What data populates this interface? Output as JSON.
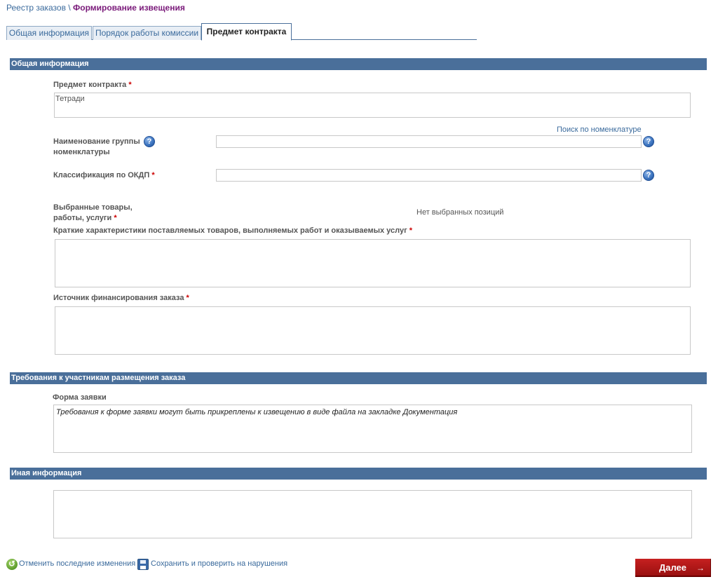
{
  "breadcrumb": {
    "root": "Реестр заказов",
    "separator": "\\",
    "current": "Формирование извещения"
  },
  "tabs": [
    {
      "label": "Общая информация",
      "active": false
    },
    {
      "label": "Порядок работы комиссии",
      "active": false
    },
    {
      "label": "Предмет контракта",
      "active": true
    }
  ],
  "sections": {
    "general": {
      "title": "Общая информация",
      "subject_label": "Предмет контракта",
      "subject_value": "Тетради",
      "search_link": "Поиск по номенклатуре",
      "group_label_line1": "Наименование группы",
      "group_label_line2": "номенклатуры",
      "group_value": "",
      "okdp_label": "Классификация по ОКДП",
      "okdp_value": "",
      "selected_label_line1": "Выбранные товары,",
      "selected_label_line2": "работы, услуги",
      "selected_empty": "Нет выбранных позиций",
      "characteristics_label": "Краткие характеристики поставляемых товаров, выполняемых работ и оказываемых услуг",
      "characteristics_value": "",
      "financing_label": "Источник финансирования заказа",
      "financing_value": ""
    },
    "requirements": {
      "title": "Требования к участникам размещения заказа",
      "form_label": "Форма заявки",
      "form_value": "Требования к форме заявки могут быть прикреплены к извещению в виде файла на закладке Документация"
    },
    "other": {
      "title": "Иная информация",
      "value": ""
    }
  },
  "required_mark": "*",
  "help_glyph": "?",
  "footer": {
    "undo_label": "Отменить последние изменения",
    "save_label": "Сохранить и проверить на нарушения",
    "next_label": "Далее",
    "next_arrow": "→"
  },
  "colors": {
    "section_bar": "#4a6f9a",
    "link": "#3a6a9c",
    "breadcrumb_current": "#7a1a7a",
    "required": "#cc0000",
    "next_button": "#b01818"
  }
}
